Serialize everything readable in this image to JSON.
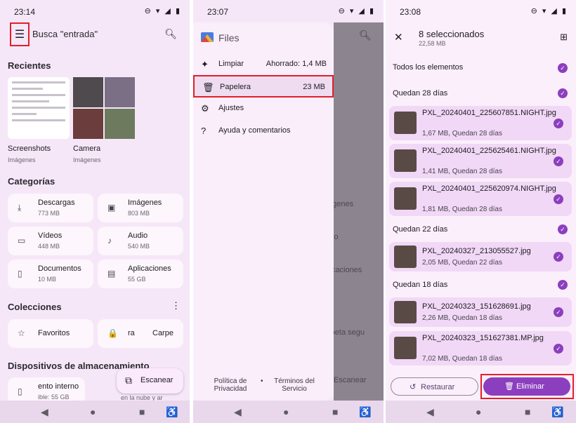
{
  "panel1": {
    "time": "23:14",
    "status_icons": "⊖ ▾ ◢ ▮",
    "search_placeholder": "Busca \"entrada\"",
    "recientes": "Recientes",
    "recent": [
      {
        "title": "Screenshots",
        "sub": "Imágenes"
      },
      {
        "title": "Camera",
        "sub": "Imágenes"
      }
    ],
    "categorias": "Categorías",
    "categories": [
      {
        "icon": "download-icon",
        "glyph": "⤓",
        "label": "Descargas",
        "size": "773 MB"
      },
      {
        "icon": "image-icon",
        "glyph": "▣",
        "label": "Imágenes",
        "size": "803 MB"
      },
      {
        "icon": "video-icon",
        "glyph": "▭",
        "label": "Vídeos",
        "size": "448 MB"
      },
      {
        "icon": "audio-icon",
        "glyph": "♪",
        "label": "Audio",
        "size": "540 MB"
      },
      {
        "icon": "document-icon",
        "glyph": "▯",
        "label": "Documentos",
        "size": "10 MB"
      },
      {
        "icon": "apps-icon",
        "glyph": "▤",
        "label": "Aplicaciones",
        "size": "55 GB"
      }
    ],
    "colecciones": "Colecciones",
    "collections": [
      {
        "glyph": "☆",
        "label": "Favoritos"
      },
      {
        "glyph": "🔒",
        "label": "Carpe",
        "prefix": "ra"
      }
    ],
    "dispositivos": "Dispositivos de almacenamiento",
    "device_label": "ento interno",
    "device_sub": "ible: 55 GB",
    "device_right": "en la nube y ar",
    "fab_label": "Escanear"
  },
  "panel2": {
    "time": "23:07",
    "status_icons": "⊖ ▾ ◢ ▮",
    "app_title": "Files",
    "items": [
      {
        "icon": "sparkle-icon",
        "glyph": "✦",
        "label": "Limpiar",
        "value": "Ahorrado: 1,4 MB"
      },
      {
        "icon": "trash-icon",
        "glyph": "🗑",
        "label": "Papelera",
        "value": "23 MB"
      },
      {
        "icon": "gear-icon",
        "glyph": "⚙",
        "label": "Ajustes",
        "value": ""
      },
      {
        "icon": "help-icon",
        "glyph": "?",
        "label": "Ayuda y comentarios",
        "value": ""
      }
    ],
    "footer_privacy": "Política de Privacidad",
    "footer_dot": "•",
    "footer_terms": "Términos del Servicio",
    "behind": [
      "ágenes",
      "dio",
      "licaciones",
      "rpeta segu",
      "Escanear"
    ]
  },
  "panel3": {
    "time": "23:08",
    "status_icons": "⊖ ▾ ◢ ▮",
    "title": "8 seleccionados",
    "subtitle": "22,58 MB",
    "all": "Todos los elementos",
    "groups": [
      {
        "label": "Quedan 28 días",
        "files": [
          {
            "name": "PXL_20240401_225607851.NIGHT.jpg",
            "meta": "1,67 MB, Quedan 28 días"
          },
          {
            "name": "PXL_20240401_225625461.NIGHT.jpg",
            "meta": "1,41 MB, Quedan 28 días"
          },
          {
            "name": "PXL_20240401_225620974.NIGHT.jpg",
            "meta": "1,81 MB, Quedan 28 días"
          }
        ]
      },
      {
        "label": "Quedan 22 días",
        "files": [
          {
            "name": "PXL_20240327_213055527.jpg",
            "meta": "2,05 MB, Quedan 22 días"
          }
        ]
      },
      {
        "label": "Quedan 18 días",
        "files": [
          {
            "name": "PXL_20240323_151628691.jpg",
            "meta": "2,26 MB, Quedan 18 días"
          },
          {
            "name": "PXL_20240323_151627381.MP.jpg",
            "meta": "7,02 MB, Quedan 18 días"
          }
        ]
      }
    ],
    "restore_label": "Restaurar",
    "delete_label": "Eliminar"
  },
  "nav": {
    "back": "◀",
    "home": "●",
    "recent": "■",
    "access": "♿"
  },
  "colors": {
    "accent": "#8b3fbe",
    "highlight": "#e0202a",
    "background": "#f6e7f8"
  }
}
